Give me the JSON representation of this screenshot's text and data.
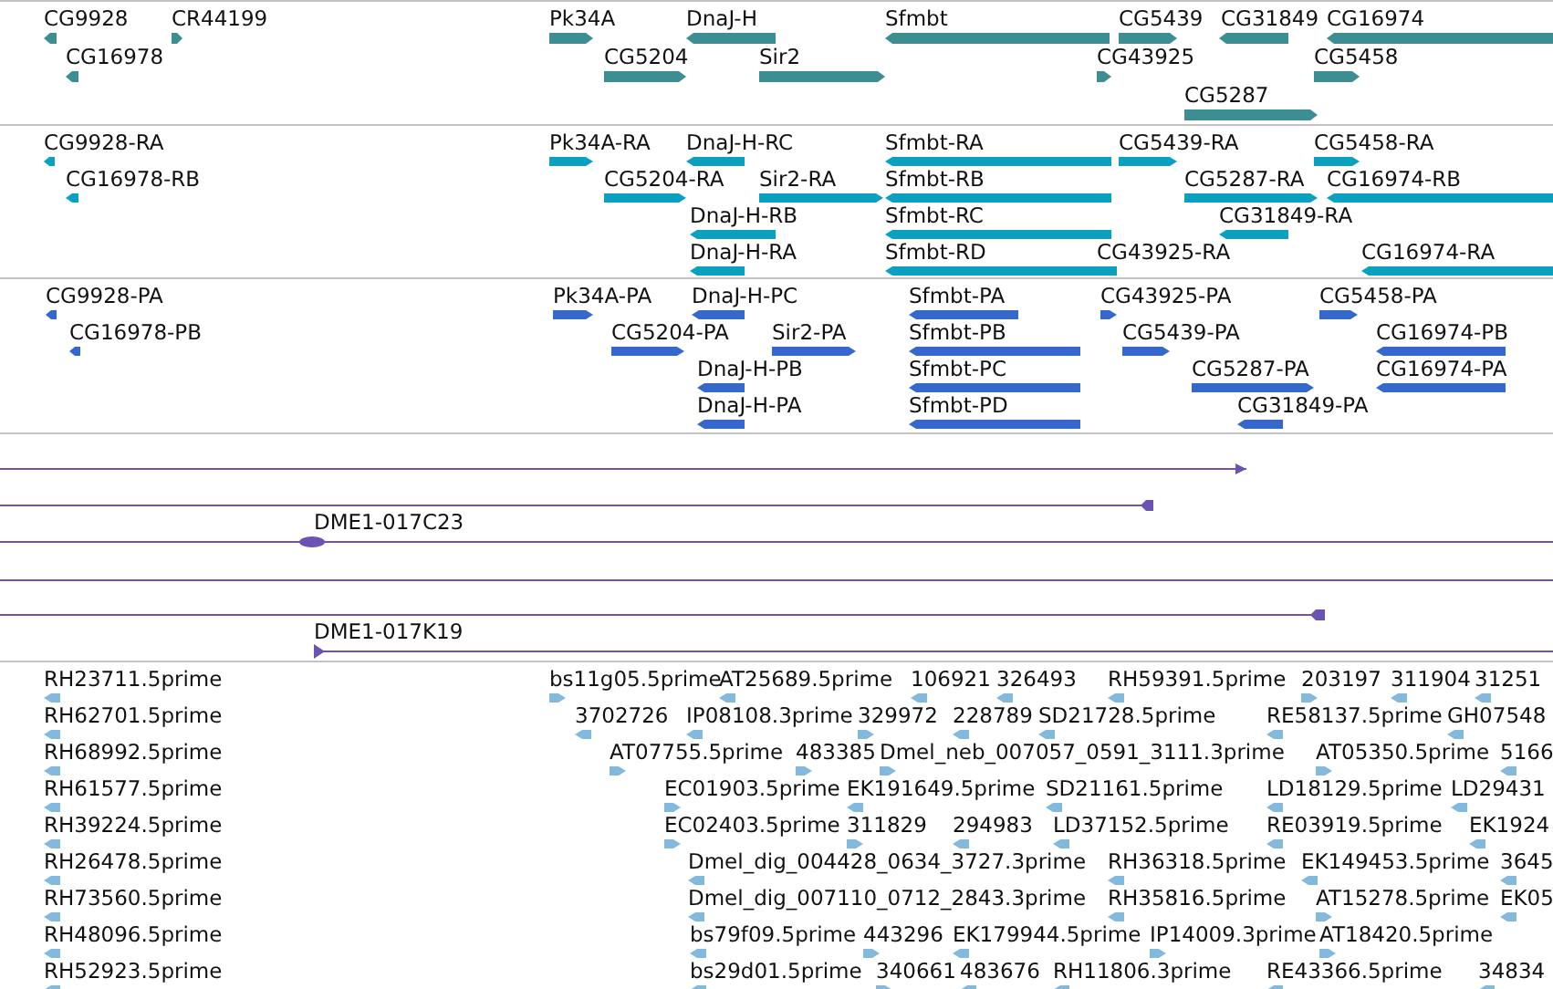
{
  "tracks": [
    {
      "kind": "gene",
      "color": "#3d8e93",
      "rows": [
        {
          "features": [
            {
              "label": "CG9928",
              "kind": "reverse"
            },
            {
              "label": "CR44199",
              "kind": "forward"
            },
            {
              "label": "Pk34A",
              "kind": "forward"
            },
            {
              "label": "DnaJ-H",
              "kind": "reverse"
            },
            {
              "label": "Sfmbt",
              "kind": "reverse"
            },
            {
              "label": "CG5439",
              "kind": "forward"
            },
            {
              "label": "CG31849",
              "kind": "reverse"
            },
            {
              "label": "CG16974",
              "kind": "reverse"
            }
          ]
        },
        {
          "features": [
            {
              "label": "CG16978",
              "kind": "reverse"
            },
            {
              "label": "CG5204",
              "kind": "forward"
            },
            {
              "label": "Sir2",
              "kind": "forward"
            },
            {
              "label": "CG43925",
              "kind": "forward"
            },
            {
              "label": "CG5458",
              "kind": "forward"
            }
          ]
        },
        {
          "features": [
            {
              "label": "CG5287",
              "kind": "forward"
            }
          ]
        }
      ]
    },
    {
      "kind": "transcript",
      "color": "#0aa0bf",
      "rows": [
        {
          "features": [
            {
              "label": "CG9928-RA",
              "kind": "reverse"
            },
            {
              "label": "Pk34A-RA",
              "kind": "forward"
            },
            {
              "label": "DnaJ-H-RC",
              "kind": "reverse"
            },
            {
              "label": "Sfmbt-RA",
              "kind": "reverse"
            },
            {
              "label": "CG5439-RA",
              "kind": "forward"
            },
            {
              "label": "CG5458-RA",
              "kind": "forward"
            }
          ]
        },
        {
          "features": [
            {
              "label": "CG16978-RB",
              "kind": "reverse"
            },
            {
              "label": "CG5204-RA",
              "kind": "forward"
            },
            {
              "label": "Sir2-RA",
              "kind": "forward"
            },
            {
              "label": "Sfmbt-RB",
              "kind": "reverse"
            },
            {
              "label": "CG5287-RA",
              "kind": "forward"
            },
            {
              "label": "CG16974-RB",
              "kind": "reverse"
            }
          ]
        },
        {
          "features": [
            {
              "label": "DnaJ-H-RB",
              "kind": "reverse"
            },
            {
              "label": "Sfmbt-RC",
              "kind": "reverse"
            },
            {
              "label": "CG31849-RA",
              "kind": "reverse"
            }
          ]
        },
        {
          "features": [
            {
              "label": "DnaJ-H-RA",
              "kind": "reverse"
            },
            {
              "label": "Sfmbt-RD",
              "kind": "reverse"
            },
            {
              "label": "CG43925-RA"
            },
            {
              "label": "CG16974-RA",
              "kind": "reverse"
            }
          ]
        }
      ]
    },
    {
      "kind": "protein",
      "color": "#3468cc",
      "rows": [
        {
          "features": [
            {
              "label": "CG9928-PA",
              "kind": "reverse"
            },
            {
              "label": "Pk34A-PA",
              "kind": "forward"
            },
            {
              "label": "DnaJ-H-PC",
              "kind": "reverse"
            },
            {
              "label": "Sfmbt-PA",
              "kind": "reverse"
            },
            {
              "label": "CG43925-PA",
              "kind": "forward"
            },
            {
              "label": "CG5458-PA",
              "kind": "forward"
            }
          ]
        },
        {
          "features": [
            {
              "label": "CG16978-PB",
              "kind": "reverse"
            },
            {
              "label": "CG5204-PA",
              "kind": "forward"
            },
            {
              "label": "Sir2-PA",
              "kind": "forward"
            },
            {
              "label": "Sfmbt-PB",
              "kind": "reverse"
            },
            {
              "label": "CG5439-PA",
              "kind": "forward"
            },
            {
              "label": "CG16974-PB",
              "kind": "reverse"
            }
          ]
        },
        {
          "features": [
            {
              "label": "DnaJ-H-PB",
              "kind": "reverse"
            },
            {
              "label": "Sfmbt-PC",
              "kind": "reverse"
            },
            {
              "label": "CG5287-PA",
              "kind": "forward"
            },
            {
              "label": "CG16974-PA",
              "kind": "reverse"
            }
          ]
        },
        {
          "features": [
            {
              "label": "DnaJ-H-PA",
              "kind": "reverse"
            },
            {
              "label": "Sfmbt-PD",
              "kind": "reverse"
            },
            {
              "label": "CG31849-PA",
              "kind": "reverse"
            }
          ]
        }
      ]
    },
    {
      "kind": "clone",
      "color": "#6b52b3",
      "clones": [
        {
          "kind": "arrow-end"
        },
        {
          "kind": "block-end"
        },
        {
          "kind": "block",
          "label": "DME1-017C23"
        },
        {
          "kind": "none"
        },
        {
          "kind": "block-end"
        },
        {
          "kind": "arrow-start",
          "label": "DME1-017K19"
        }
      ]
    },
    {
      "kind": "est",
      "color": "#84b9de",
      "rows": [
        {
          "features": [
            {
              "label": "RH23711.5prime",
              "kind": "reverse"
            },
            {
              "label": "bs11g05.5prime",
              "kind": "forward"
            },
            {
              "label": "AT25689.5prime",
              "kind": "reverse"
            },
            {
              "label": "106921",
              "kind": "reverse"
            },
            {
              "label": "326493",
              "kind": "reverse"
            },
            {
              "label": "RH59391.5prime",
              "kind": "reverse"
            },
            {
              "label": "203197",
              "kind": "forward"
            },
            {
              "label": "311904",
              "kind": "reverse"
            },
            {
              "label": "31251",
              "kind": "reverse"
            }
          ]
        },
        {
          "features": [
            {
              "label": "RH62701.5prime",
              "kind": "reverse"
            },
            {
              "label": "3702726",
              "kind": "reverse"
            },
            {
              "label": "IP08108.3prime",
              "kind": "reverse"
            },
            {
              "label": "329972",
              "kind": "forward"
            },
            {
              "label": "228789",
              "kind": "reverse"
            },
            {
              "label": "SD21728.5prime",
              "kind": "reverse"
            },
            {
              "label": "RE58137.5prime",
              "kind": "reverse"
            },
            {
              "label": "GH07548",
              "kind": "reverse"
            }
          ]
        },
        {
          "features": [
            {
              "label": "RH68992.5prime",
              "kind": "reverse"
            },
            {
              "label": "AT07755.5prime",
              "kind": "forward"
            },
            {
              "label": "483385",
              "kind": "forward"
            },
            {
              "label": "Dmel_neb_007057_0591_3111.3prime",
              "kind": "forward"
            },
            {
              "label": "AT05350.5prime",
              "kind": "forward"
            },
            {
              "label": "5166",
              "kind": "reverse"
            }
          ]
        },
        {
          "features": [
            {
              "label": "RH61577.5prime",
              "kind": "reverse"
            },
            {
              "label": "EC01903.5prime",
              "kind": "forward"
            },
            {
              "label": "EK191649.5prime",
              "kind": "reverse"
            },
            {
              "label": "SD21161.5prime",
              "kind": "reverse"
            },
            {
              "label": "LD18129.5prime",
              "kind": "reverse"
            },
            {
              "label": "LD29431",
              "kind": "reverse"
            }
          ]
        },
        {
          "features": [
            {
              "label": "RH39224.5prime",
              "kind": "reverse"
            },
            {
              "label": "EC02403.5prime",
              "kind": "forward"
            },
            {
              "label": "311829",
              "kind": "forward"
            },
            {
              "label": "294983",
              "kind": "reverse"
            },
            {
              "label": "LD37152.5prime",
              "kind": "reverse"
            },
            {
              "label": "RE03919.5prime",
              "kind": "reverse"
            },
            {
              "label": "EK1924",
              "kind": "reverse"
            }
          ]
        },
        {
          "features": [
            {
              "label": "RH26478.5prime",
              "kind": "reverse"
            },
            {
              "label": "Dmel_dig_004428_0634_3727.3prime",
              "kind": "reverse"
            },
            {
              "label": "RH36318.5prime",
              "kind": "reverse"
            },
            {
              "label": "EK149453.5prime",
              "kind": "reverse"
            },
            {
              "label": "3645",
              "kind": "reverse"
            }
          ]
        },
        {
          "features": [
            {
              "label": "RH73560.5prime",
              "kind": "reverse"
            },
            {
              "label": "Dmel_dig_007110_0712_2843.3prime",
              "kind": "reverse"
            },
            {
              "label": "RH35816.5prime",
              "kind": "reverse"
            },
            {
              "label": "AT15278.5prime",
              "kind": "forward"
            },
            {
              "label": "EK05",
              "kind": "reverse"
            }
          ]
        },
        {
          "features": [
            {
              "label": "RH48096.5prime",
              "kind": "reverse"
            },
            {
              "label": "bs79f09.5prime",
              "kind": "reverse"
            },
            {
              "label": "443296",
              "kind": "forward"
            },
            {
              "label": "EK179944.5prime",
              "kind": "reverse"
            },
            {
              "label": "IP14009.3prime",
              "kind": "forward"
            },
            {
              "label": "AT18420.5prime",
              "kind": "forward"
            }
          ]
        },
        {
          "features": [
            {
              "label": "RH52923.5prime",
              "kind": "reverse"
            },
            {
              "label": "bs29d01.5prime",
              "kind": "reverse"
            },
            {
              "label": "340661",
              "kind": "forward"
            },
            {
              "label": "483676",
              "kind": "reverse"
            },
            {
              "label": "RH11806.3prime",
              "kind": "reverse"
            },
            {
              "label": "RE43366.5prime",
              "kind": "reverse"
            },
            {
              "label": "34834",
              "kind": "reverse"
            }
          ]
        }
      ]
    }
  ]
}
